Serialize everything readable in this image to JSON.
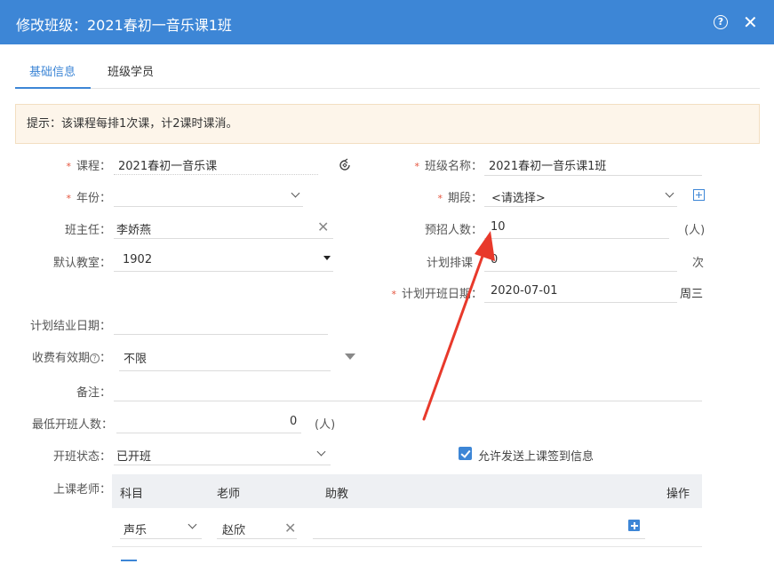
{
  "window": {
    "title": "修改班级：2021春初一音乐课1班",
    "help_icon": "question-circle-icon",
    "help_glyph": "?",
    "close_icon": "close-icon",
    "close_glyph": "✕"
  },
  "tabs": [
    {
      "label": "基础信息",
      "active": true
    },
    {
      "label": "班级学员",
      "active": false
    }
  ],
  "notice": "提示：该课程每排1次课，计2课时课消。",
  "form": {
    "course": {
      "label": "课程：",
      "value": "2021春初一音乐课"
    },
    "class_name": {
      "label": "班级名称：",
      "value": "2021春初一音乐课1班"
    },
    "year": {
      "label": "年份：",
      "value": ""
    },
    "term": {
      "label": "期段：",
      "value": "<请选择>"
    },
    "head_teacher": {
      "label": "班主任：",
      "value": "李娇燕"
    },
    "planned_enroll": {
      "label": "预招人数：",
      "value": "10",
      "unit": "(人)"
    },
    "default_room": {
      "label": "默认教室：",
      "value": "1902"
    },
    "planned_sessions": {
      "label": "计划排课",
      "value": "0",
      "unit": "次"
    },
    "start_date": {
      "label": "计划开班日期：",
      "value": "2020-07-01",
      "weekday": "周三"
    },
    "end_date": {
      "label": "计划结业日期：",
      "value": ""
    },
    "fee_validity": {
      "label": "收费有效期",
      "help": "?",
      "colon": "：",
      "value": "不限"
    },
    "remark": {
      "label": "备注：",
      "value": ""
    },
    "min_students": {
      "label": "最低开班人数：",
      "value": "0",
      "unit": "(人)"
    },
    "status": {
      "label": "开班状态：",
      "value": "已开班"
    },
    "allow_checkin": {
      "label": "允许发送上课签到信息",
      "checked": true
    },
    "teachers": {
      "label": "上课老师："
    }
  },
  "teacher_table": {
    "headers": [
      "科目",
      "老师",
      "助教",
      "操作"
    ],
    "rows": [
      {
        "subject": "声乐",
        "teacher": "赵欣",
        "assistant": ""
      }
    ]
  },
  "required_mark": "*",
  "clear_glyph": "✕",
  "colors": {
    "accent": "#3d86d6",
    "required": "#e5533c",
    "annotation_arrow": "#e8392b",
    "notice_bg": "#fdf5ea"
  }
}
